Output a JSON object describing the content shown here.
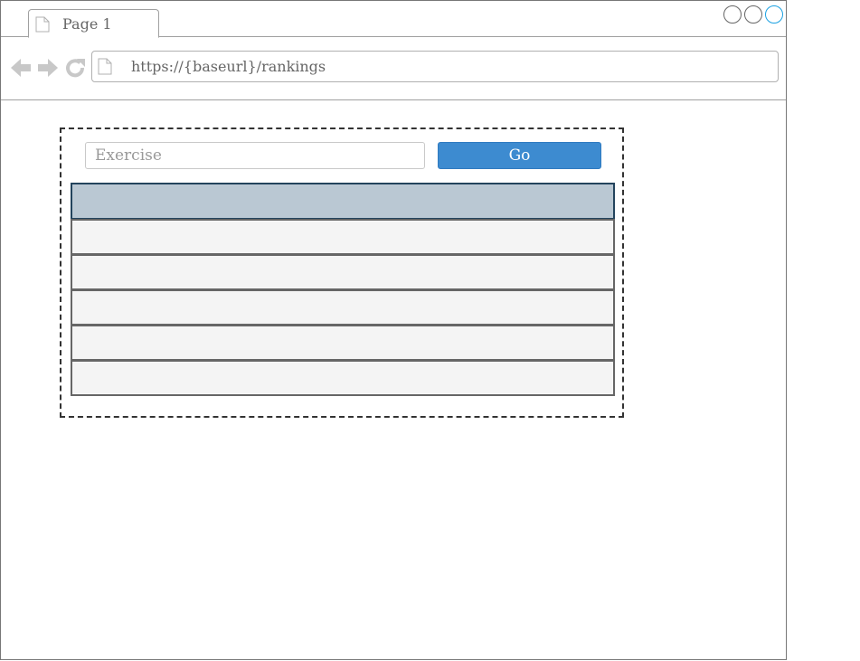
{
  "window": {
    "tab_title": "Page 1",
    "controls": [
      "minimize-button",
      "maximize-button",
      "close-button"
    ]
  },
  "navigation": {
    "url": "https://{baseurl}/rankings",
    "icons": [
      "back-arrow-icon",
      "forward-arrow-icon",
      "reload-icon",
      "document-icon"
    ]
  },
  "search": {
    "placeholder": "Exercise",
    "value": "",
    "go_label": "Go"
  },
  "rankings_table": {
    "header": [
      ""
    ],
    "rows": [
      [
        ""
      ],
      [
        ""
      ],
      [
        ""
      ],
      [
        ""
      ],
      [
        ""
      ]
    ]
  },
  "colors": {
    "go_button": "#3d8bd0",
    "table_header": "#bac8d3",
    "table_header_border": "#23445d",
    "table_row": "#f4f4f4",
    "active_window_control": "#1ba1e2"
  }
}
